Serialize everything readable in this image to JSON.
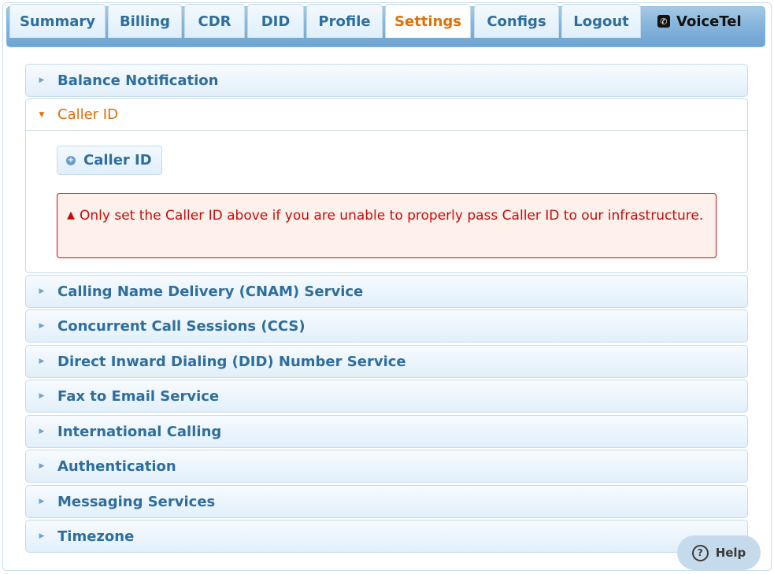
{
  "nav": {
    "tabs": [
      {
        "label": "Summary"
      },
      {
        "label": "Billing"
      },
      {
        "label": "CDR"
      },
      {
        "label": "DID"
      },
      {
        "label": "Profile"
      },
      {
        "label": "Settings",
        "active": true
      },
      {
        "label": "Configs"
      },
      {
        "label": "Logout"
      }
    ],
    "brand": "VoiceTel",
    "brand_icon": "phone-icon"
  },
  "sections": [
    {
      "label": "Balance Notification"
    },
    {
      "label": "Caller ID",
      "expanded": true
    },
    {
      "label": "Calling Name Delivery (CNAM) Service"
    },
    {
      "label": "Concurrent Call Sessions (CCS)"
    },
    {
      "label": "Direct Inward Dialing (DID) Number Service"
    },
    {
      "label": "Fax to Email Service"
    },
    {
      "label": "International Calling"
    },
    {
      "label": "Authentication"
    },
    {
      "label": "Messaging Services"
    },
    {
      "label": "Timezone"
    }
  ],
  "caller_id_panel": {
    "add_button_label": "Caller ID",
    "warning_text": "Only set the Caller ID above if you are unable to properly pass Caller ID to our infrastructure."
  },
  "help": {
    "label": "Help"
  },
  "colors": {
    "accent": "#e17009",
    "primary_text": "#2e6e9e",
    "warning": "#cd0a0a",
    "header_bg": "#87b5dc"
  }
}
